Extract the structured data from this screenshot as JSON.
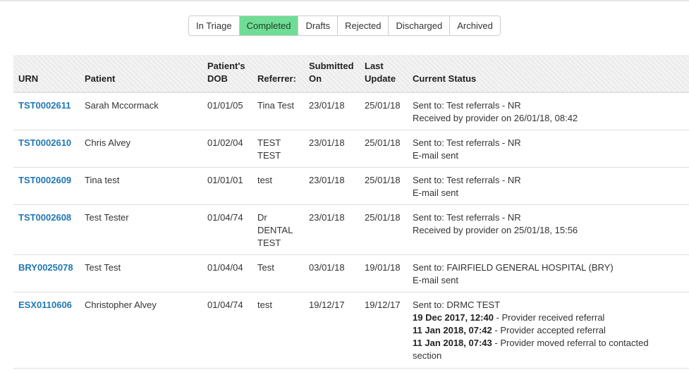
{
  "tabs": [
    {
      "label": "In Triage",
      "active": false
    },
    {
      "label": "Completed",
      "active": true
    },
    {
      "label": "Drafts",
      "active": false
    },
    {
      "label": "Rejected",
      "active": false
    },
    {
      "label": "Discharged",
      "active": false
    },
    {
      "label": "Archived",
      "active": false
    }
  ],
  "colors": {
    "active_tab": "#6fdd95",
    "link": "#1f78b4"
  },
  "columns": {
    "urn": "URN",
    "patient": "Patient",
    "dob_line1": "Patient's",
    "dob_line2": "DOB",
    "referrer": "Referrer:",
    "submitted_line1": "Submitted",
    "submitted_line2": "On",
    "last_update_line1": "Last",
    "last_update_line2": "Update",
    "status": "Current Status"
  },
  "rows": [
    {
      "urn": "TST0002611",
      "patient": "Sarah Mccormack",
      "dob": "01/01/05",
      "referrer": [
        "Tina Test"
      ],
      "submitted": "23/01/18",
      "last_update": "25/01/18",
      "status": [
        {
          "bold": "",
          "text": "Sent to: Test referrals - NR"
        },
        {
          "bold": "",
          "text": "Received by provider on 26/01/18, 08:42"
        }
      ]
    },
    {
      "urn": "TST0002610",
      "patient": "Chris Alvey",
      "dob": "01/02/04",
      "referrer": [
        "TEST",
        "TEST"
      ],
      "submitted": "23/01/18",
      "last_update": "25/01/18",
      "status": [
        {
          "bold": "",
          "text": "Sent to: Test referrals - NR"
        },
        {
          "bold": "",
          "text": "E-mail sent"
        }
      ]
    },
    {
      "urn": "TST0002609",
      "patient": "Tina test",
      "dob": "01/01/01",
      "referrer": [
        "test"
      ],
      "submitted": "23/01/18",
      "last_update": "25/01/18",
      "status": [
        {
          "bold": "",
          "text": "Sent to: Test referrals - NR"
        },
        {
          "bold": "",
          "text": "E-mail sent"
        }
      ]
    },
    {
      "urn": "TST0002608",
      "patient": "Test Tester",
      "dob": "01/04/74",
      "referrer": [
        "Dr",
        "DENTAL",
        "TEST"
      ],
      "submitted": "23/01/18",
      "last_update": "25/01/18",
      "status": [
        {
          "bold": "",
          "text": "Sent to: Test referrals - NR"
        },
        {
          "bold": "",
          "text": "Received by provider on 25/01/18, 15:56"
        }
      ]
    },
    {
      "urn": "BRY0025078",
      "patient": "Test Test",
      "dob": "01/04/04",
      "referrer": [
        "Test"
      ],
      "submitted": "03/01/18",
      "last_update": "19/01/18",
      "status": [
        {
          "bold": "",
          "text": "Sent to: FAIRFIELD GENERAL HOSPITAL (BRY)"
        },
        {
          "bold": "",
          "text": "E-mail sent"
        }
      ]
    },
    {
      "urn": "ESX0110606",
      "patient": "Christopher Alvey",
      "dob": "01/04/74",
      "referrer": [
        "test"
      ],
      "submitted": "19/12/17",
      "last_update": "19/12/17",
      "status": [
        {
          "bold": "",
          "text": "Sent to: DRMC TEST"
        },
        {
          "bold": "19 Dec 2017, 12:40",
          "text": " - Provider received referral"
        },
        {
          "bold": "11 Jan 2018, 07:42",
          "text": " - Provider accepted referral"
        },
        {
          "bold": "11 Jan 2018, 07:43",
          "text": " - Provider moved referral to contacted"
        },
        {
          "bold": "",
          "text": "section"
        }
      ]
    }
  ]
}
